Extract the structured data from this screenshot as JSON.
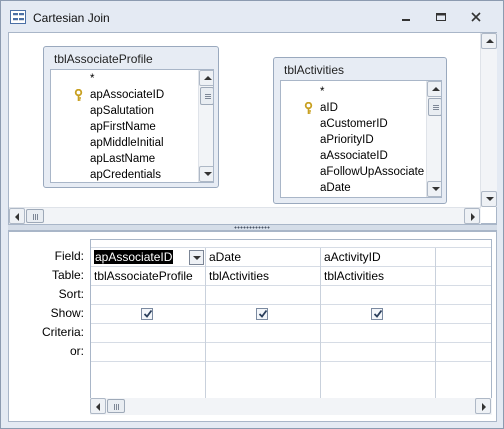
{
  "window": {
    "title": "Cartesian Join"
  },
  "tables": [
    {
      "name": "tblAssociateProfile",
      "fields": [
        "*",
        "apAssociateID",
        "apSalutation",
        "apFirstName",
        "apMiddleInitial",
        "apLastName",
        "apCredentials"
      ],
      "primary_key_index": 1
    },
    {
      "name": "tblActivities",
      "fields": [
        "*",
        "aID",
        "aCustomerID",
        "aPriorityID",
        "aAssociateID",
        "aFollowUpAssociate",
        "aDate"
      ],
      "primary_key_index": 1
    }
  ],
  "grid": {
    "row_labels": [
      "Field:",
      "Table:",
      "Sort:",
      "Show:",
      "Criteria:",
      "or:"
    ],
    "columns": [
      {
        "field": "apAssociateID",
        "table": "tblAssociateProfile",
        "sort": "",
        "show": true,
        "criteria": "",
        "or": "",
        "selected": true
      },
      {
        "field": "aDate",
        "table": "tblActivities",
        "sort": "",
        "show": true,
        "criteria": "",
        "or": "",
        "selected": false
      },
      {
        "field": "aActivityID",
        "table": "tblActivities",
        "sort": "",
        "show": true,
        "criteria": "",
        "or": "",
        "selected": false
      }
    ]
  },
  "icons": {
    "window_icon": "query-icon",
    "key": "primary-key-icon",
    "minimize": "minimize-icon",
    "restore": "restore-icon",
    "close": "close-icon"
  },
  "colors": {
    "selection": "#000000",
    "window_bg": "#e4eaf3",
    "key_gold": "#c8a021"
  }
}
